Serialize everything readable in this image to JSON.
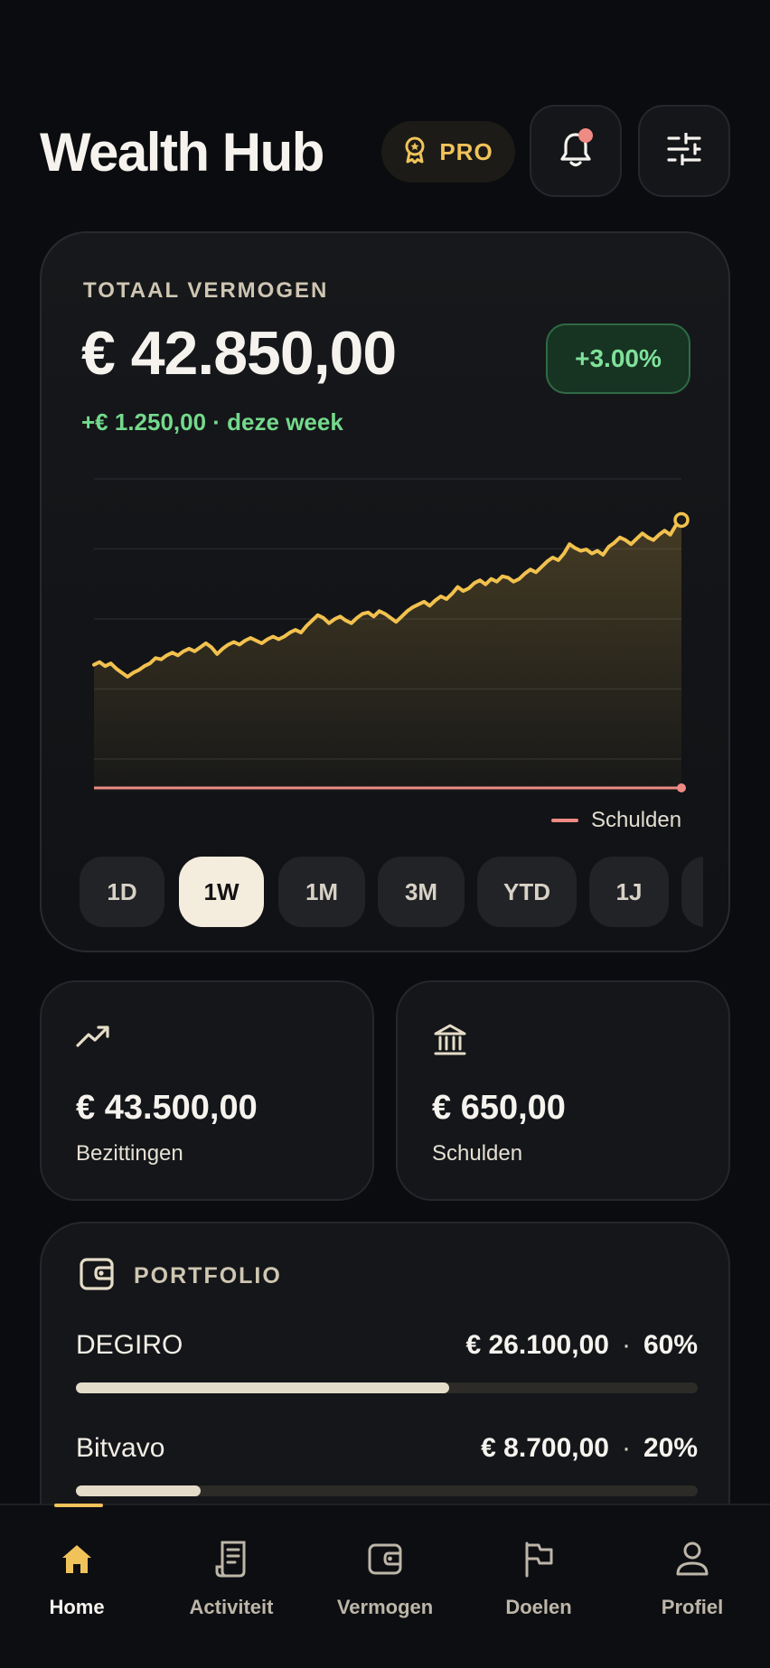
{
  "header": {
    "title": "Wealth Hub",
    "pro_label": "PRO",
    "icons": {
      "pro": "award-icon",
      "bell": "bell-icon",
      "filter": "sliders-icon"
    },
    "colors": {
      "accent": "#f0c35a",
      "notification_dot": "#f08a84"
    }
  },
  "total": {
    "label": "TOTAAL VERMOGEN",
    "amount": "€ 42.850,00",
    "change_pct": "+3.00%",
    "week_change": "+€ 1.250,00 · deze week"
  },
  "chart_data": {
    "type": "line",
    "title": "",
    "xlabel": "",
    "ylabel": "",
    "grid": true,
    "legend_position": "bottom-right",
    "series": [
      {
        "role": "wealth",
        "color": "#f2c14e",
        "values": [
          100,
          102,
          99,
          101,
          97,
          94,
          91,
          94,
          96,
          99,
          101,
          105,
          104,
          107,
          109,
          107,
          110,
          112,
          110,
          113,
          116,
          113,
          108,
          112,
          115,
          117,
          115,
          118,
          120,
          118,
          116,
          119,
          121,
          119,
          121,
          124,
          126,
          124,
          129,
          133,
          137,
          135,
          131,
          134,
          136,
          133,
          131,
          135,
          138,
          139,
          136,
          140,
          138,
          135,
          132,
          136,
          140,
          143,
          145,
          147,
          144,
          148,
          151,
          149,
          153,
          158,
          155,
          157,
          161,
          163,
          160,
          164,
          162,
          166,
          165,
          162,
          164,
          168,
          171,
          169,
          173,
          177,
          180,
          178,
          183,
          190,
          187,
          185,
          186,
          183,
          185,
          182,
          188,
          191,
          195,
          193,
          190,
          194,
          198,
          195,
          193,
          197,
          200,
          197,
          204,
          208
        ]
      },
      {
        "name": "Schulden",
        "role": "debt",
        "color": "#ee8a83",
        "values": [
          0,
          0
        ]
      }
    ],
    "ylim": [
      0,
      240
    ],
    "legend": [
      {
        "label": "Schulden",
        "color": "#ee8a83"
      }
    ]
  },
  "ranges": {
    "items": [
      {
        "label": "1D",
        "active": false
      },
      {
        "label": "1W",
        "active": true
      },
      {
        "label": "1M",
        "active": false
      },
      {
        "label": "3M",
        "active": false
      },
      {
        "label": "YTD",
        "active": false
      },
      {
        "label": "1J",
        "active": false
      },
      {
        "label": "",
        "active": false
      }
    ]
  },
  "stats": {
    "assets": {
      "amount": "€ 43.500,00",
      "label": "Bezittingen",
      "icon": "trending-up-icon"
    },
    "debts": {
      "amount": "€ 650,00",
      "label": "Schulden",
      "icon": "bank-icon"
    }
  },
  "portfolio": {
    "title": "PORTFOLIO",
    "icon": "wallet-icon",
    "items": [
      {
        "name": "DEGIRO",
        "value": "€ 26.100,00",
        "sep": "·",
        "pct": "60%",
        "fraction": 0.6
      },
      {
        "name": "Bitvavo",
        "value": "€ 8.700,00",
        "sep": "·",
        "pct": "20%",
        "fraction": 0.2
      }
    ]
  },
  "nav": {
    "items": [
      {
        "label": "Home",
        "icon": "home-icon",
        "active": true
      },
      {
        "label": "Activiteit",
        "icon": "receipt-icon",
        "active": false
      },
      {
        "label": "Vermogen",
        "icon": "wallet-icon",
        "active": false
      },
      {
        "label": "Doelen",
        "icon": "flag-icon",
        "active": false
      },
      {
        "label": "Profiel",
        "icon": "user-icon",
        "active": false
      }
    ]
  }
}
